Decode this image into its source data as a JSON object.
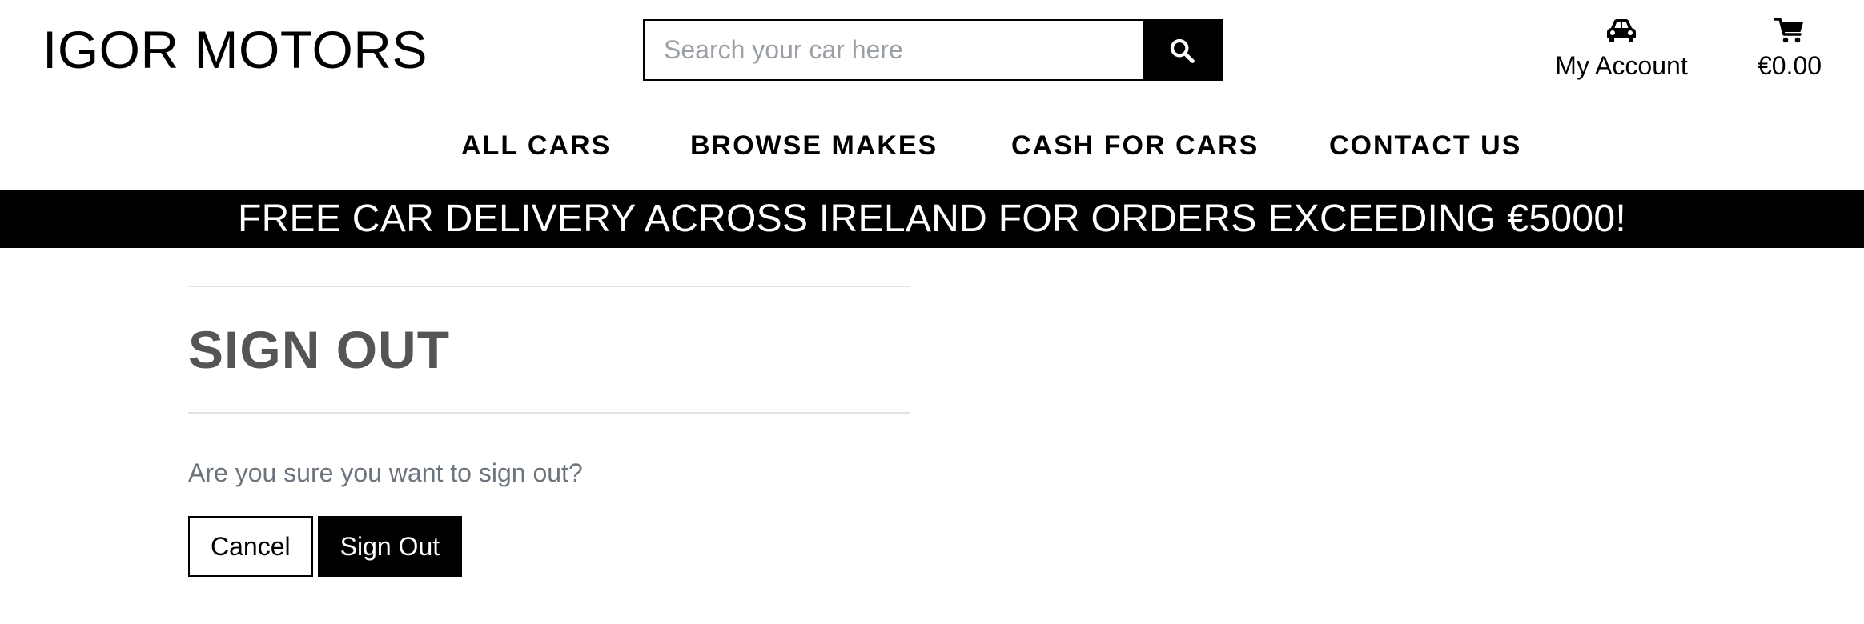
{
  "brand": {
    "logo_text": "IGOR MOTORS"
  },
  "search": {
    "placeholder": "Search your car here",
    "value": "",
    "button_icon": "search-icon"
  },
  "account": {
    "icon": "car-icon",
    "label": "My Account"
  },
  "cart": {
    "icon": "shopping-cart-icon",
    "total": "€0.00"
  },
  "nav": {
    "items": [
      {
        "label": "ALL CARS"
      },
      {
        "label": "BROWSE MAKES"
      },
      {
        "label": "CASH FOR CARS"
      },
      {
        "label": "CONTACT US"
      }
    ]
  },
  "banner": {
    "text": "FREE CAR DELIVERY ACROSS IRELAND FOR ORDERS EXCEEDING €5000!"
  },
  "signout": {
    "title": "SIGN OUT",
    "question": "Are you sure you want to sign out?",
    "cancel_label": "Cancel",
    "confirm_label": "Sign Out"
  },
  "colors": {
    "primary": "#000000",
    "background": "#ffffff",
    "heading": "#555555",
    "muted_text": "#6c757d",
    "divider": "#e3e3e3"
  }
}
